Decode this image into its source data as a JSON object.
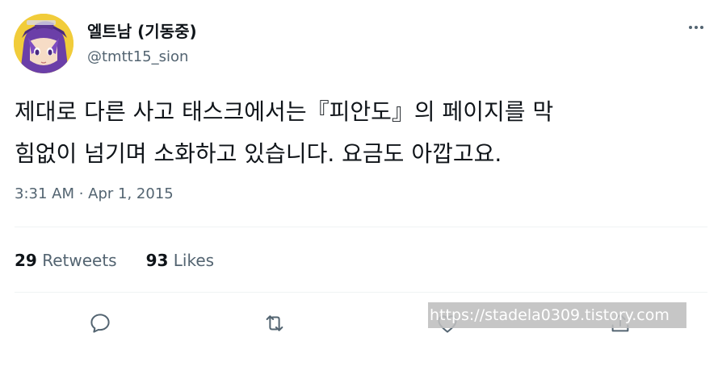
{
  "author": {
    "display_name": "엘트남 (기동중)",
    "handle": "@tmtt15_sion",
    "avatar_icon": "anime-character-avatar"
  },
  "tweet": {
    "text_line_1": "제대로 다른 사고 태스크에서는『피안도』의 페이지를 막",
    "text_line_2": "힘없이 넘기며 소화하고 있습니다. 요금도 아깝고요.",
    "timestamp": "3:31 AM · Apr 1, 2015"
  },
  "stats": {
    "retweets_count": "29",
    "retweets_label": "Retweets",
    "likes_count": "93",
    "likes_label": "Likes"
  },
  "actions": {
    "icons": [
      "reply-icon",
      "retweet-icon",
      "like-icon",
      "share-icon"
    ],
    "more_icon": "more-dots-icon"
  },
  "watermark": {
    "text": "https://stadela0309.tistory.com"
  },
  "colors": {
    "primary_text": "#0f1419",
    "secondary_text": "#536471",
    "divider": "#eff3f4",
    "icon": "#536471"
  }
}
